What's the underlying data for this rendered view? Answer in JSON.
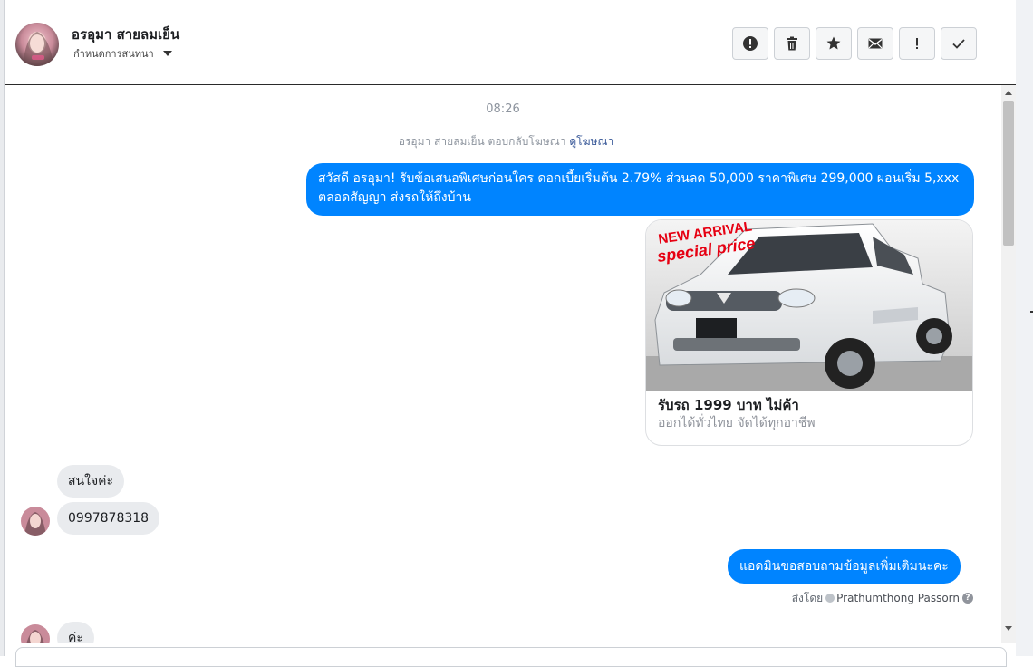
{
  "header": {
    "name": "อรอุมา สายลมเย็น",
    "subtitle": "กำหนดการสนทนา"
  },
  "tools": {
    "icons": [
      "alert-circle-icon",
      "trash-icon",
      "star-icon",
      "envelope-icon",
      "exclamation-icon",
      "check-icon"
    ]
  },
  "thread": {
    "timestamp": "08:26",
    "ad_note_prefix": "อรอุมา สายลมเย็น ตอบกลับโฆษณา",
    "ad_note_link": "ดูโฆษณา",
    "messages": {
      "out_1": "สวัสดี อรอุมา! รับข้อเสนอพิเศษก่อนใคร ดอกเบี้ยเริ่มต้น 2.79%  ส่วนลด 50,000 ราคาพิเศษ 299,000 ผ่อนเริ่ม 5,xxx ตลอดสัญญา ส่งรถให้ถึงบ้าน",
      "in_1": "สนใจค่ะ",
      "in_2": "0997878318",
      "out_2": "แอดมินขอสอบถามข้อมูลเพิ่มเติมนะคะ",
      "in_3": "ค่ะ"
    },
    "card": {
      "image_text": "NEW ARRIVAL special price",
      "title": "รับรถ 1999 บาท ไม่ค้า",
      "subtitle": "ออกได้ทั่วไทย จัดได้ทุกอาชีพ"
    },
    "sent_by": {
      "label": "ส่งโดย",
      "who": "Prathumthong Passorn"
    }
  },
  "colors": {
    "outgoing_bubble": "#0084ff",
    "incoming_bubble": "#e9ebee",
    "link": "#385898"
  }
}
